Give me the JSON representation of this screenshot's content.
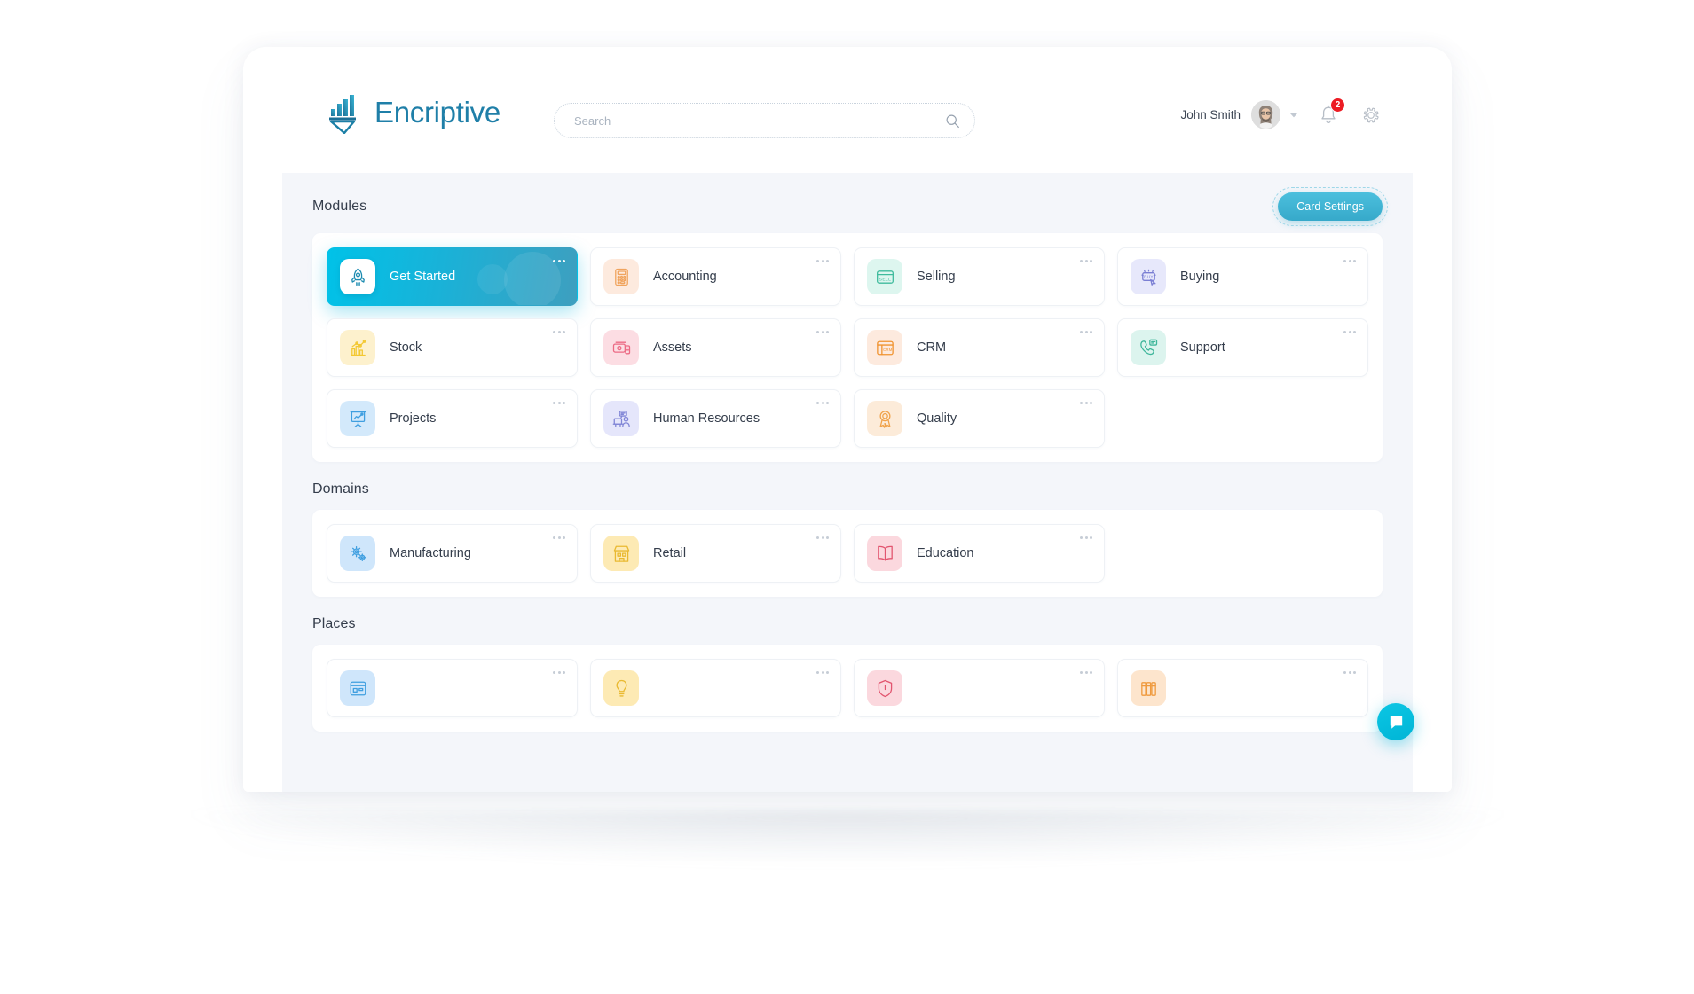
{
  "header": {
    "brand": "Encriptive",
    "logo_icon": "bar-chart-logo-icon",
    "search": {
      "value": "",
      "placeholder": "Search",
      "icon": "search-icon"
    },
    "user_name": "John Smith",
    "avatar_icon": "user-avatar",
    "chevron_icon": "chevron-down-icon",
    "bell_icon": "bell-icon",
    "notification_count": "2",
    "gear_icon": "gear-icon"
  },
  "sections": [
    {
      "title": "Modules",
      "action_label": "Card Settings",
      "cards": [
        {
          "label": "Get Started",
          "icon": "rocket-icon",
          "active": true,
          "tint": "#ffffff",
          "stroke": "#1c8bb0"
        },
        {
          "label": "Accounting",
          "icon": "calculator-icon",
          "active": false,
          "tint": "#fdeade",
          "stroke": "#f0a45e"
        },
        {
          "label": "Selling",
          "icon": "sell-tag-icon",
          "active": false,
          "tint": "#ddf6ef",
          "stroke": "#3fbb9d"
        },
        {
          "label": "Buying",
          "icon": "buy-cart-icon",
          "active": false,
          "tint": "#e7e8fb",
          "stroke": "#7b7fd4"
        },
        {
          "label": "Stock",
          "icon": "bar-chart-icon",
          "active": false,
          "tint": "#fdf1cd",
          "stroke": "#f3c832"
        },
        {
          "label": "Assets",
          "icon": "wallet-icon",
          "active": false,
          "tint": "#fcdde3",
          "stroke": "#ec6a84"
        },
        {
          "label": "CRM",
          "icon": "crm-window-icon",
          "active": false,
          "tint": "#fdeade",
          "stroke": "#f0932f"
        },
        {
          "label": "Support",
          "icon": "phone-chat-icon",
          "active": false,
          "tint": "#dcf4ee",
          "stroke": "#3fb69b"
        },
        {
          "label": "Projects",
          "icon": "presentation-icon",
          "active": false,
          "tint": "#d3e9fb",
          "stroke": "#3f9fe0"
        },
        {
          "label": "Human Resources",
          "icon": "people-desk-icon",
          "active": false,
          "tint": "#e5e6fb",
          "stroke": "#8085d6"
        },
        {
          "label": "Quality",
          "icon": "award-ribbon-icon",
          "active": false,
          "tint": "#fcebd9",
          "stroke": "#f0a24a"
        }
      ]
    },
    {
      "title": "Domains",
      "cards": [
        {
          "label": "Manufacturing",
          "icon": "gears-icon",
          "active": false,
          "tint": "#cfe6fb",
          "stroke": "#3f9fe0"
        },
        {
          "label": "Retail",
          "icon": "store-icon",
          "active": false,
          "tint": "#fdeab4",
          "stroke": "#e9b931"
        },
        {
          "label": "Education",
          "icon": "book-icon",
          "active": false,
          "tint": "#fbd8de",
          "stroke": "#e2556f"
        }
      ]
    },
    {
      "title": "Places",
      "cards": [
        {
          "label": "",
          "icon": "storefront-icon",
          "active": false,
          "tint": "#cfe6fb",
          "stroke": "#3f9fe0"
        },
        {
          "label": "",
          "icon": "bulb-icon",
          "active": false,
          "tint": "#fdeab4",
          "stroke": "#e9b931"
        },
        {
          "label": "",
          "icon": "shield-icon",
          "active": false,
          "tint": "#fbd8de",
          "stroke": "#e2556f"
        },
        {
          "label": "",
          "icon": "books-icon",
          "active": false,
          "tint": "#fde5cd",
          "stroke": "#ef9a3e"
        }
      ]
    }
  ],
  "chat": {
    "icon": "chat-bubble-icon"
  },
  "colors": {
    "accent": "#00c2e8",
    "accent_deep": "#3e9fbf",
    "badge_red": "#ec1c24",
    "surface": "#f4f6fa",
    "text": "#343d4b",
    "brand_blue": "#1f7fa8"
  }
}
